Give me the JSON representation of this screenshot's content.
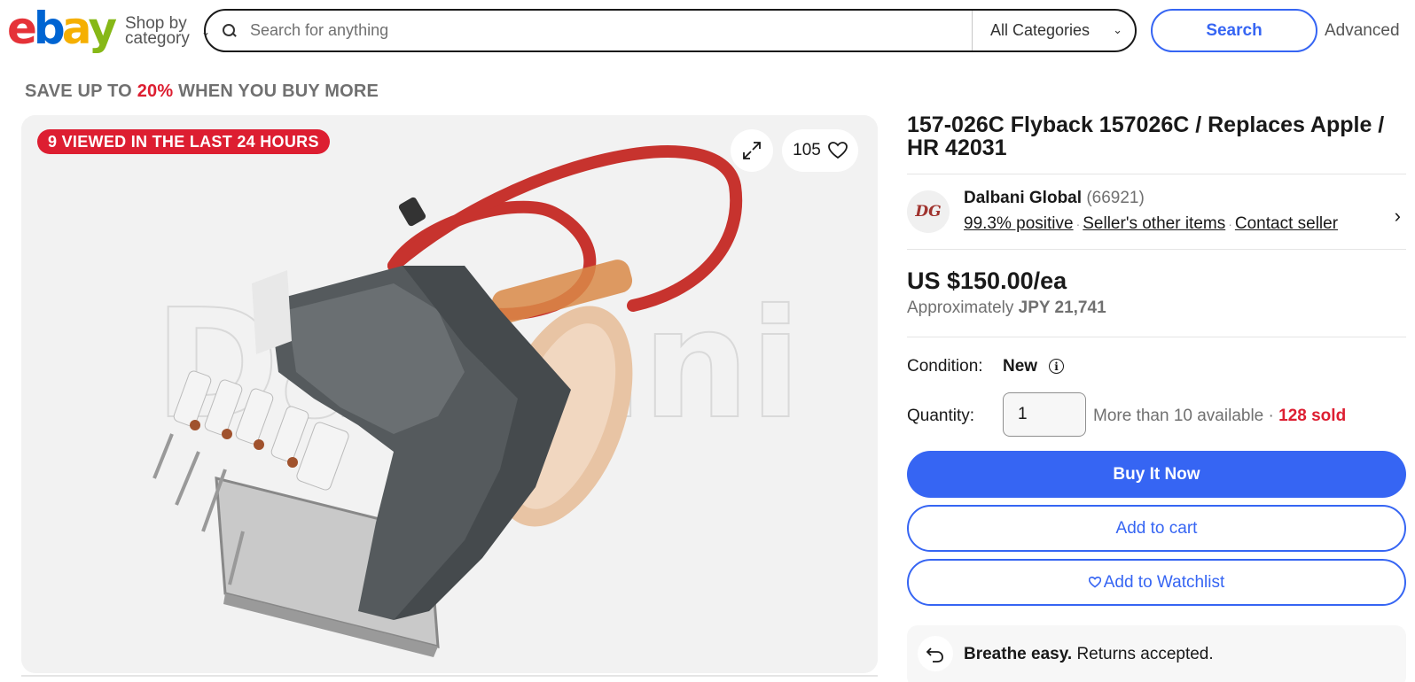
{
  "header": {
    "logo": [
      "e",
      "b",
      "a",
      "y"
    ],
    "shop_by_line1": "Shop by",
    "shop_by_line2": "category",
    "search_placeholder": "Search for anything",
    "category_label": "All Categories",
    "search_button": "Search",
    "advanced_link": "Advanced"
  },
  "promo": {
    "prefix": "SAVE UP TO ",
    "percent": "20%",
    "suffix": " WHEN YOU BUY MORE"
  },
  "gallery": {
    "viewed_badge": "9 VIEWED IN THE LAST 24 HOURS",
    "watch_count": "105",
    "watermark": "Dalbani"
  },
  "product": {
    "title": "157-026C Flyback 157026C / Replaces Apple / HR 42031",
    "price": "US $150.00/ea",
    "approx_label": "Approximately ",
    "approx_value": "JPY 21,741"
  },
  "seller": {
    "avatar_initials": "DG",
    "name": "Dalbani Global",
    "feedback_count": "(66921)",
    "positive": "99.3% positive",
    "other_items": "Seller's other items",
    "contact": "Contact seller"
  },
  "details": {
    "condition_label": "Condition:",
    "condition_value": "New",
    "quantity_label": "Quantity:",
    "quantity_value": "1",
    "availability": "More than 10 available",
    "sold": "128 sold"
  },
  "actions": {
    "buy_now": "Buy It Now",
    "add_to_cart": "Add to cart",
    "add_to_watchlist": "Add to Watchlist"
  },
  "returns": {
    "bold": "Breathe easy.",
    "text": " Returns accepted."
  },
  "colors": {
    "brand_blue": "#3665f3",
    "badge_red": "#dd1e31",
    "logo_red": "#e53238",
    "logo_blue": "#0064d2",
    "logo_yellow": "#f5af02",
    "logo_green": "#86b817"
  }
}
